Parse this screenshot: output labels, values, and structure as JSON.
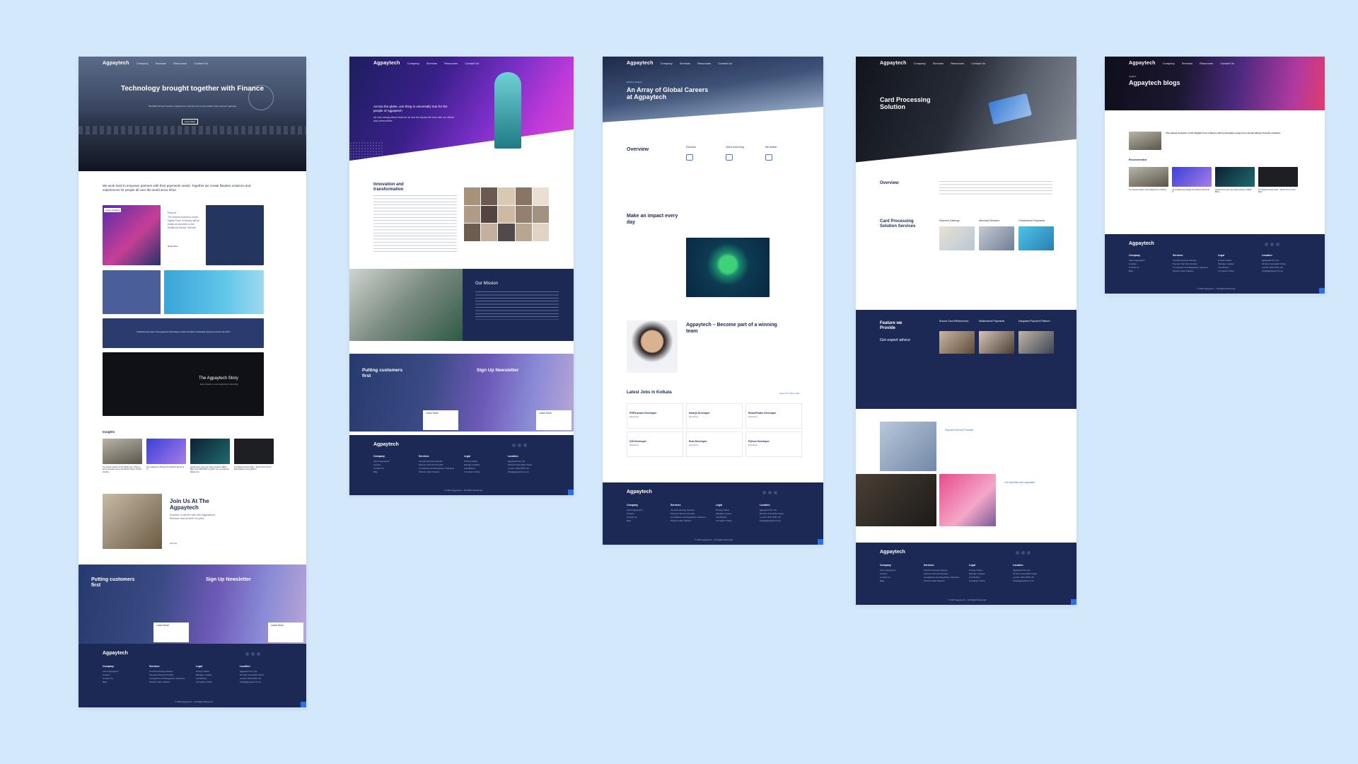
{
  "brand": "Agpaytech",
  "nav": [
    "Company",
    "Services",
    "Resources",
    "Contact Us"
  ],
  "p1": {
    "hero_title": "Technology brought together with Finance",
    "hero_sub": "Simplified Fintech solution engineered to provide secure and reliable online payment gateway",
    "hero_btn": "Learn More",
    "intro": "We work hard to empower partners with their payments needs. Together we create flawless solutions and experiences for people all over the world since 2012.",
    "tag1": "Latest Updates",
    "card_title": "Report",
    "card_text": "The federal evolution of this Digital Form of Money will be finally as sensitive to the Multifocal Money Transfer",
    "read_more": "Read More",
    "quote": "“ Unleashing the power of the Agpaytech technology to create and deliver outstanding experiences across the world ”",
    "story": "The Agpaytech Story",
    "story_sub": "Every chapter is a new beginning of something",
    "insights": "Insights",
    "insight_items": [
      "The federal evolution of this Digital Form of Money will be favorable using Cross Border Money Transfer activities",
      "Can a Metaverse Change The World As We Know It?",
      "Infrastructure costs may reduce between US$10 Billion and US$2 Billion by 2022? You can make the Mastermind",
      "The Bahamas Sand Dollar – World's First Central Bank Digital Currency(CBDC)"
    ],
    "join_title": "Join Us At The Agpaytech",
    "join_text": "Explore a career with the Agpaytech. Browse and search for jobs.",
    "join_link": "Join Us",
    "putting": "Putting customers first",
    "signup": "Sign Up Newsletter",
    "learn": "Learn More"
  },
  "p2": {
    "hero_text": "Across the globe, one thing is universally true for the people of Agpaytech",
    "hero_sub": "we care deeply about what we do and the impact we have with our clients and communities",
    "innov": "Innovation and transformation",
    "mission": "Our Mission",
    "putting": "Putting customers first",
    "signup": "Sign Up Newsletter"
  },
  "p3": {
    "hero_kicker": "Explore Careers",
    "hero_title": "An Array of Global Careers at Agpaytech",
    "overview": "Overview",
    "cols": [
      "Freedom",
      "Client is the king",
      "We deliver"
    ],
    "impact": "Make an impact every day",
    "team": "Agpaytech – Become part of a winning team",
    "jobs_title": "Latest Jobs in Kolkata",
    "jobs_link": "Search for More Jobs",
    "jobs": [
      "PHP/Laravel Developer",
      "Nodejs Developer",
      "React/Flutter Developer",
      "iOS Developer",
      "Rust Developer",
      "Python Developer"
    ],
    "exp": "Experience:"
  },
  "p4": {
    "hero_title": "Card Processing Solution",
    "overview": "Overview",
    "services": "Card Processing Solution Services",
    "svc": [
      "Payment Gateway",
      "Merchant Services",
      "Omnichannel Payments"
    ],
    "feature": "Feature we Provide",
    "expert": "Get expert advice",
    "feat": [
      "Ensure Card Effectiveness",
      "Multichannel Payments",
      "Integrated Payment Platform"
    ],
    "pp": "Payment Service Provider",
    "cd": "Cut Optimise and regulation"
  },
  "p5": {
    "hero_kicker": "Insights",
    "hero_title": "Agpaytech blogs",
    "lead": "The natural evolution of this Digital Form of Money will be favorable using Cross Border Money Transfer activities",
    "recommended": "Recommended",
    "recs": [
      "The natural evolution of the Digital Form of Money",
      "Can a Metaverse Change The World As We Know It?",
      "Infrastructure costs may reduce between US$10 Billion",
      "The Bahamas Sand Dollar – World's First Central Bank"
    ]
  },
  "footer": {
    "cols": [
      "Company",
      "Services",
      "Legal",
      "Location"
    ],
    "company": "About Agpaytech\nCareers\nContact Us\nBlog",
    "services": "Card Processing Solution\nPayment Service Provider\nCompliance and Regulatory Solutions\nFintech Label Solution",
    "legal": "Privacy Notice\nManage Cookies\nAnti-Bribery\nCorruption Policy",
    "location": "agpaytech ltd, info\n64 New Cavendish Street\nLondon W1G 8TB, UK\ninfo@agpaytech.co.uk",
    "copyright": "© 2022 Agpaytech – All Rights Reserved"
  },
  "colors": {
    "bg": "#d4e8fb",
    "navy": "#1c2954",
    "accent": "#2c6fe6",
    "purple": "#7a3fe0",
    "magenta": "#c03ad8"
  }
}
